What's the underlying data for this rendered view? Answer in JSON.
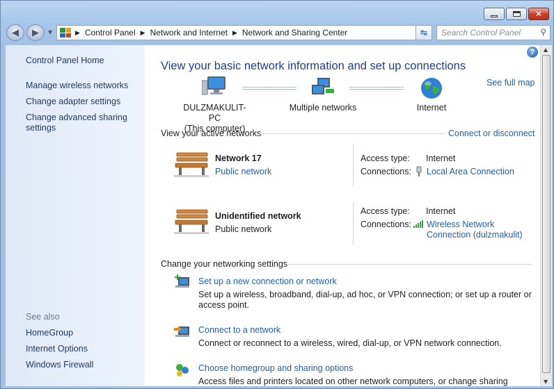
{
  "window": {
    "title_buttons": [
      "minimize",
      "maximize",
      "close"
    ],
    "close_glyph": "✕"
  },
  "nav": {
    "back_glyph": "◀",
    "forward_glyph": "▶",
    "breadcrumb": [
      "Control Panel",
      "Network and Internet",
      "Network and Sharing Center"
    ],
    "search_placeholder": "Search Control Panel"
  },
  "sidebar": {
    "home": "Control Panel Home",
    "items": [
      "Manage wireless networks",
      "Change adapter settings",
      "Change advanced sharing settings"
    ],
    "see_also_label": "See also",
    "see_also": [
      "HomeGroup",
      "Internet Options",
      "Windows Firewall"
    ]
  },
  "main": {
    "help_glyph": "?",
    "title": "View your basic network information and set up connections",
    "see_full_map": "See full map",
    "map": {
      "computer_name": "DULZMAKULIT-PC",
      "computer_sub": "(This computer)",
      "middle": "Multiple networks",
      "internet": "Internet"
    },
    "active_heading": "View your active networks",
    "connect_link": "Connect or disconnect",
    "networks": [
      {
        "name": "Network  17",
        "type": "Public network",
        "type_is_link": true,
        "access_label": "Access type:",
        "access": "Internet",
        "conn_label": "Connections:",
        "conn_line1": "Local Area Connection",
        "conn_line2": ""
      },
      {
        "name": "Unidentified network",
        "type": "Public network",
        "type_is_link": false,
        "access_label": "Access type:",
        "access": "Internet",
        "conn_label": "Connections:",
        "conn_line1": "Wireless Network",
        "conn_line2": "Connection (dulzmakulit)"
      }
    ],
    "settings_heading": "Change your networking settings",
    "tasks": [
      {
        "link": "Set up a new connection or network",
        "desc1": "Set up a wireless, broadband, dial-up, ad hoc, or VPN connection; or set up a router or",
        "desc2": "access point."
      },
      {
        "link": "Connect to a network",
        "desc1": "Connect or reconnect to a wireless, wired, dial-up, or VPN network connection.",
        "desc2": ""
      },
      {
        "link": "Choose homegroup and sharing options",
        "desc1": "Access files and printers located on other network computers, or change sharing settings.",
        "desc2": ""
      }
    ]
  },
  "colors": {
    "link": "#1f5fa6",
    "title": "#1e3f8a",
    "sidebar_bg": "#dfe9f7"
  }
}
